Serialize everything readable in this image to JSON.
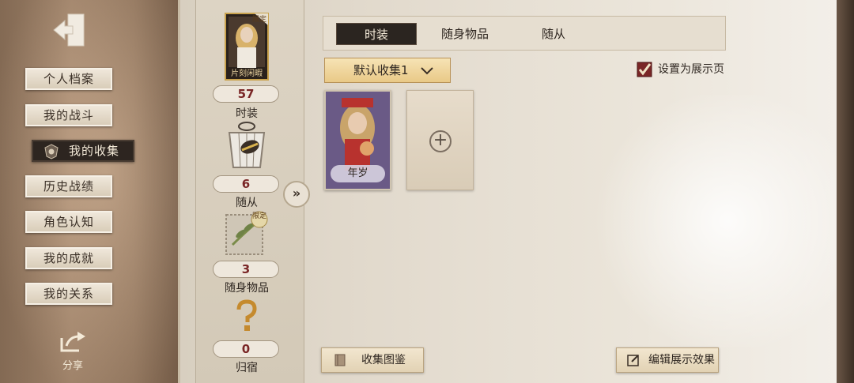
{
  "sidebar": {
    "items": [
      {
        "label": "个人档案"
      },
      {
        "label": "我的战斗"
      },
      {
        "label": "我的收集"
      },
      {
        "label": "历史战绩"
      },
      {
        "label": "角色认知"
      },
      {
        "label": "我的成就"
      },
      {
        "label": "我的关系"
      }
    ],
    "active_index": 2,
    "share_label": "分享"
  },
  "stats": {
    "portrait_caption": "片刻闲暇",
    "limited_badge": "限定",
    "items": [
      {
        "count": "57",
        "label": "时装"
      },
      {
        "count": "6",
        "label": "随从"
      },
      {
        "count": "3",
        "label": "随身物品",
        "badge": "限定"
      },
      {
        "count": "0",
        "label": "归宿"
      }
    ]
  },
  "tabs": [
    {
      "label": "时装",
      "active": true
    },
    {
      "label": "随身物品",
      "active": false
    },
    {
      "label": "随从",
      "active": false
    }
  ],
  "dropdown": {
    "selected": "默认收集1"
  },
  "showcase_toggle": {
    "label": "设置为展示页",
    "checked": true
  },
  "cards": [
    {
      "caption": "年岁"
    }
  ],
  "buttons": {
    "collection_guide": "收集图鉴",
    "edit_display": "编辑展示效果"
  },
  "colors": {
    "accent_red": "#7a2626",
    "dark_tab": "#2b2520",
    "gold_dropdown": "#e9c987"
  }
}
